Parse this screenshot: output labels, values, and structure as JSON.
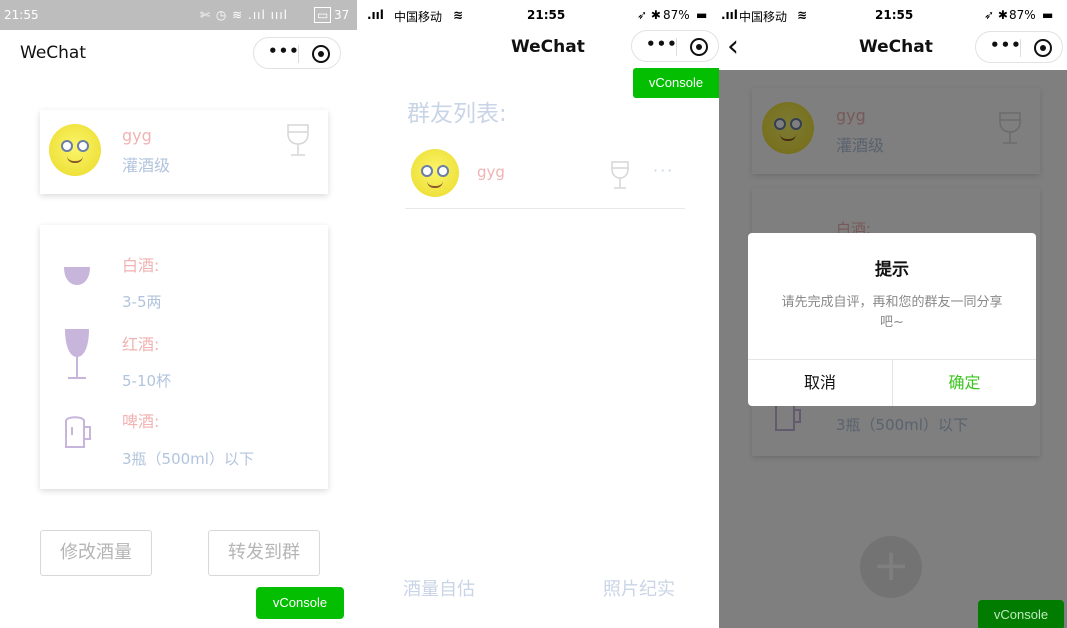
{
  "panel1": {
    "status": {
      "time": "21:55",
      "icons": "✄ ◷ ≋ .ııl ıııl",
      "battery": "37"
    },
    "title": "WeChat",
    "profile": {
      "name": "gyg",
      "level": "灌酒级"
    },
    "drinks": [
      {
        "icon": "baijiu-bowl-icon",
        "label": "白酒:",
        "amount": "3-5两"
      },
      {
        "icon": "red-wine-glass-icon",
        "label": "红酒:",
        "amount": "5-10杯"
      },
      {
        "icon": "beer-mug-icon",
        "label": "啤酒:",
        "amount": "3瓶（500ml）以下"
      }
    ],
    "buttons": {
      "modify": "修改酒量",
      "forward": "转发到群"
    },
    "vconsole": "vConsole"
  },
  "panel2": {
    "status": {
      "carrier": "中国移动",
      "time": "21:55",
      "battery": "87%"
    },
    "title": "WeChat",
    "vconsole": "vConsole",
    "list_title": "群友列表:",
    "member": {
      "name": "gyg",
      "more": "···"
    },
    "tabs": {
      "left": "酒量自估",
      "right": "照片纪实"
    }
  },
  "panel3": {
    "status": {
      "carrier": "中国移动",
      "time": "21:55",
      "battery": "87%"
    },
    "title": "WeChat",
    "back": "‹",
    "profile": {
      "name": "gyg",
      "level": "灌酒级"
    },
    "behind_label": "白酒:",
    "behind_amount": "3瓶（500ml）以下",
    "dialog": {
      "title": "提示",
      "message": "请先完成自评，再和您的群友一同分享吧~",
      "cancel": "取消",
      "confirm": "确定"
    },
    "add": "+",
    "vconsole": "vConsole"
  },
  "colors": {
    "accent_green": "#04be02",
    "confirm_green": "#3cc51f"
  }
}
